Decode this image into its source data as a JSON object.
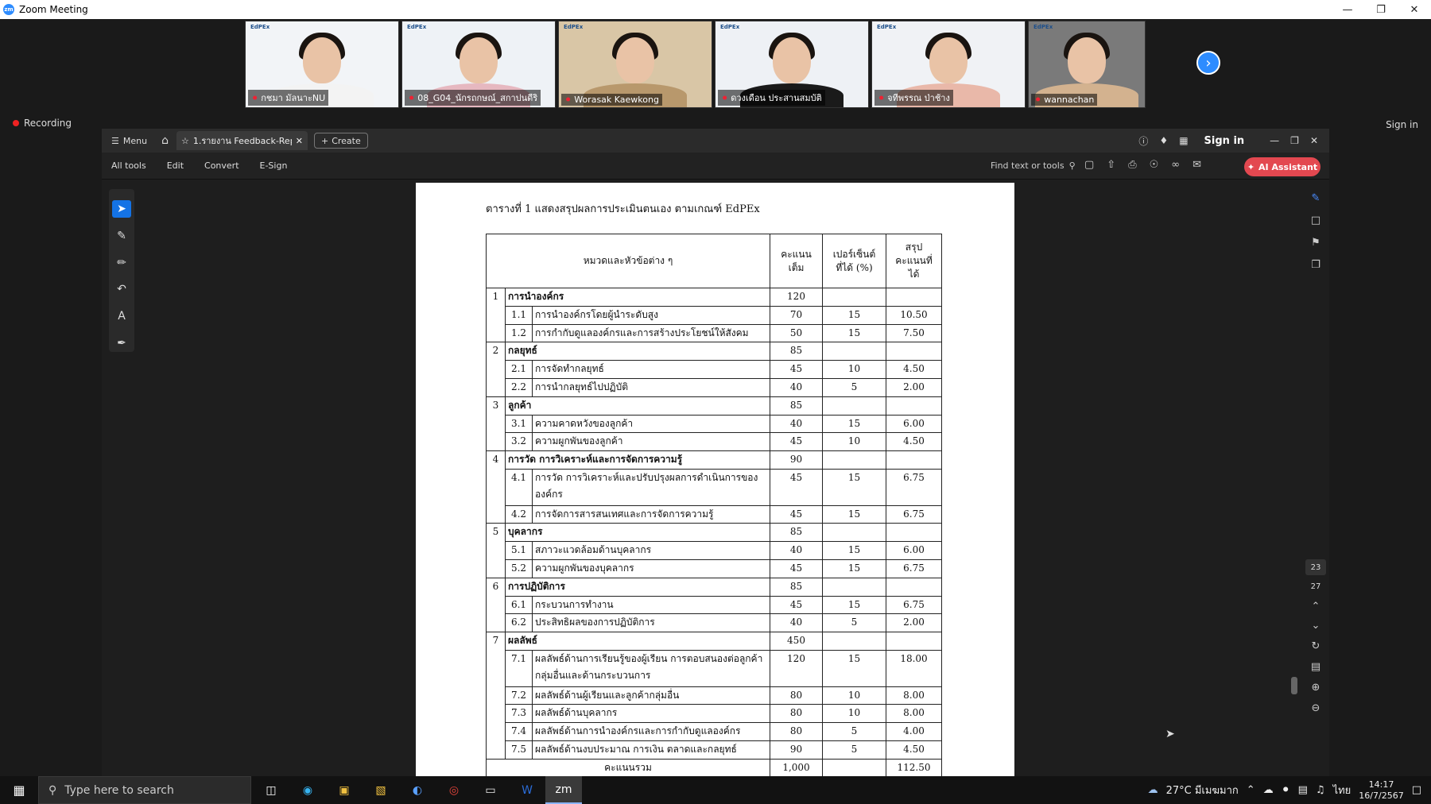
{
  "window": {
    "title": "Zoom Meeting"
  },
  "participants": [
    {
      "name": "กชมา มัลนาะNU",
      "bg": "#f2f4f7",
      "shirt": "#f3f3f3"
    },
    {
      "name": "08_G04_นักรถกษณ์_สกาปนดีริ",
      "bg": "#eef2f6",
      "shirt": "#e6b8c0"
    },
    {
      "name": "Worasak Kaewkong",
      "bg": "#d9c6a6",
      "shirt": "#b8986c"
    },
    {
      "name": "ดวงเดือน ประสานสมบัติ",
      "bg": "#eef1f5",
      "shirt": "#1a1a1a"
    },
    {
      "name": "จทีพรรณ ป่าช้าง",
      "bg": "#f0f2f5",
      "shirt": "#e9b8a9"
    },
    {
      "name": "wannachan",
      "bg": "#7a7a7a",
      "shirt": "#d3b28f"
    }
  ],
  "recording_label": "Recording",
  "zoom_signin": "Sign in",
  "acrobat": {
    "menu_label": "Menu",
    "tab_title": "1.รายงาน Feedback-Repor...",
    "create_label": "Create",
    "signin_label": "Sign in",
    "tools": [
      "All tools",
      "Edit",
      "Convert",
      "E-Sign"
    ],
    "find_placeholder": "Find text or tools",
    "ai_label": "AI Assistant",
    "page_current": "23",
    "page_total": "27"
  },
  "document": {
    "caption": "ตารางที่ 1 แสดงสรุปผลการประเมินตนเอง ตามเกณฑ์ EdPEx",
    "headers": {
      "category": "หมวดและหัวข้อต่าง ๆ",
      "full_score": "คะแนน\nเต็ม",
      "percent": "เปอร์เซ็นต์\nที่ได้ (%)",
      "summary": "สรุป\nคะแนนที่\nได้"
    },
    "categories": [
      {
        "num": "1",
        "name": "การนำองค์กร",
        "full": "120",
        "items": [
          {
            "id": "1.1",
            "name": "การนำองค์กรโดยผู้นำระดับสูง",
            "full": "70",
            "pct": "15",
            "score": "10.50"
          },
          {
            "id": "1.2",
            "name": "การกำกับดูแลองค์กรและการสร้างประโยชน์ให้สังคม",
            "full": "50",
            "pct": "15",
            "score": "7.50"
          }
        ]
      },
      {
        "num": "2",
        "name": "กลยุทธ์",
        "full": "85",
        "items": [
          {
            "id": "2.1",
            "name": "การจัดทำกลยุทธ์",
            "full": "45",
            "pct": "10",
            "score": "4.50"
          },
          {
            "id": "2.2",
            "name": "การนำกลยุทธ์ไปปฏิบัติ",
            "full": "40",
            "pct": "5",
            "score": "2.00"
          }
        ]
      },
      {
        "num": "3",
        "name": "ลูกค้า",
        "full": "85",
        "items": [
          {
            "id": "3.1",
            "name": "ความคาดหวังของลูกค้า",
            "full": "40",
            "pct": "15",
            "score": "6.00"
          },
          {
            "id": "3.2",
            "name": "ความผูกพันของลูกค้า",
            "full": "45",
            "pct": "10",
            "score": "4.50"
          }
        ]
      },
      {
        "num": "4",
        "name": "การวัด การวิเคราะห์และการจัดการความรู้",
        "full": "90",
        "items": [
          {
            "id": "4.1",
            "name": "การวัด การวิเคราะห์และปรับปรุงผลการดำเนินการขององค์กร",
            "full": "45",
            "pct": "15",
            "score": "6.75",
            "tall": true
          },
          {
            "id": "4.2",
            "name": "การจัดการสารสนเทศและการจัดการความรู้",
            "full": "45",
            "pct": "15",
            "score": "6.75"
          }
        ]
      },
      {
        "num": "5",
        "name": "บุคลากร",
        "full": "85",
        "items": [
          {
            "id": "5.1",
            "name": "สภาวะแวดล้อมด้านบุคลากร",
            "full": "40",
            "pct": "15",
            "score": "6.00"
          },
          {
            "id": "5.2",
            "name": "ความผูกพันของบุคลากร",
            "full": "45",
            "pct": "15",
            "score": "6.75"
          }
        ]
      },
      {
        "num": "6",
        "name": "การปฏิบัติการ",
        "full": "85",
        "items": [
          {
            "id": "6.1",
            "name": "กระบวนการทำงาน",
            "full": "45",
            "pct": "15",
            "score": "6.75"
          },
          {
            "id": "6.2",
            "name": "ประสิทธิผลของการปฏิบัติการ",
            "full": "40",
            "pct": "5",
            "score": "2.00"
          }
        ]
      },
      {
        "num": "7",
        "name": "ผลลัพธ์",
        "full": "450",
        "items": [
          {
            "id": "7.1",
            "name": "ผลลัพธ์ด้านการเรียนรู้ของผู้เรียน การตอบสนองต่อลูกค้ากลุ่มอื่นและด้านกระบวนการ",
            "full": "120",
            "pct": "15",
            "score": "18.00",
            "tall": true
          },
          {
            "id": "7.2",
            "name": "ผลลัพธ์ด้านผู้เรียนและลูกค้ากลุ่มอื่น",
            "full": "80",
            "pct": "10",
            "score": "8.00"
          },
          {
            "id": "7.3",
            "name": "ผลลัพธ์ด้านบุคลากร",
            "full": "80",
            "pct": "10",
            "score": "8.00"
          },
          {
            "id": "7.4",
            "name": "ผลลัพธ์ด้านการนำองค์กรและการกำกับดูแลองค์กร",
            "full": "80",
            "pct": "5",
            "score": "4.00"
          },
          {
            "id": "7.5",
            "name": "ผลลัพธ์ด้านงบประมาณ การเงิน ตลาดและกลยุทธ์",
            "full": "90",
            "pct": "5",
            "score": "4.50"
          }
        ]
      }
    ],
    "total": {
      "label": "คะแนนรวม",
      "full": "1,000",
      "score": "112.50"
    }
  },
  "taskbar": {
    "search_placeholder": "Type here to search",
    "weather": "27°C มีเมฆมาก",
    "lang": "ไทย",
    "time": "14:17",
    "date": "16/7/2567"
  }
}
